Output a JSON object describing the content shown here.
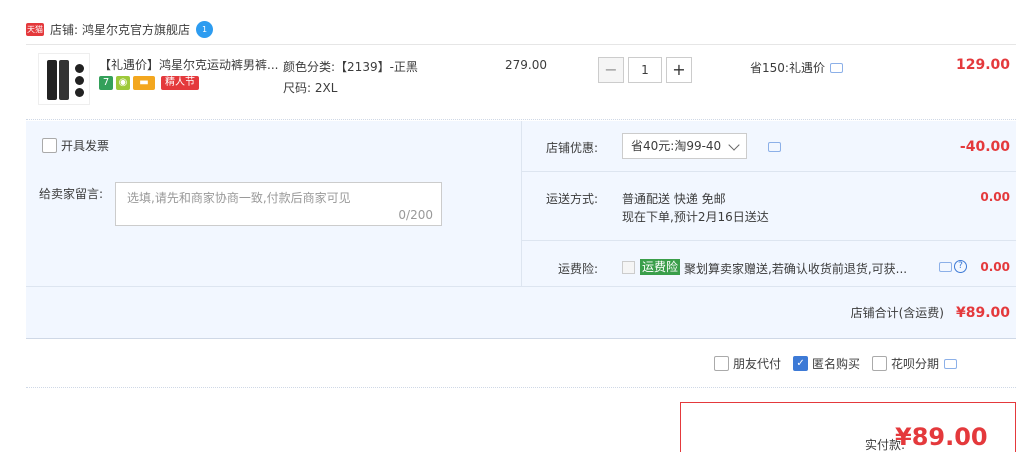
{
  "shop": {
    "badge": "天猫",
    "label": "店铺:",
    "name": "鸿星尔克官方旗舰店",
    "ww_badge": "1"
  },
  "item": {
    "title": "【礼遇价】鸿星尔克运动裤男裤...",
    "tags": [
      {
        "text": "7",
        "color": "#33a05a"
      },
      {
        "text": "◉",
        "color": "#9ec93a"
      },
      {
        "text": "▬",
        "color": "#f3a71f"
      }
    ],
    "festival_tag": "精人节",
    "attr_color": "颜色分类:【2139】-正黑",
    "attr_size": "尺码: 2XL",
    "unit_price": "279.00",
    "quantity": "1",
    "minus": "−",
    "plus": "+",
    "saving": "省150:礼遇价",
    "total": "129.00"
  },
  "options": {
    "invoice_label": "开具发票",
    "message_label": "给卖家留言:",
    "message_placeholder": "选填,请先和商家协商一致,付款后商家可见",
    "message_count": "0/200",
    "shop_discount_label": "店铺优惠:",
    "shop_discount_value": "省40元:淘99-40",
    "shop_discount_amount": "-40.00",
    "shipping_label": "运送方式:",
    "shipping_line1": "普通配送 快递 免邮",
    "shipping_line2": "现在下单,预计2月16日送达",
    "shipping_fee": "0.00",
    "insurance_label": "运费险:",
    "insurance_tag": "运费险",
    "insurance_text": "聚划算卖家赠送,若确认收货前退货,可获...",
    "insurance_fee": "0.00",
    "subtotal_label": "店铺合计(含运费)",
    "subtotal_amount": "¥89.00"
  },
  "payment_options": [
    {
      "label": "朋友代付",
      "checked": false
    },
    {
      "label": "匿名购买",
      "checked": true
    },
    {
      "label": "花呗分期",
      "checked": false
    }
  ],
  "pay": {
    "label": "实付款:",
    "amount": "¥89.00"
  },
  "colors": {
    "accent": "#e4393c",
    "panel": "#f2f7ff",
    "link": "#3d7ad6"
  }
}
